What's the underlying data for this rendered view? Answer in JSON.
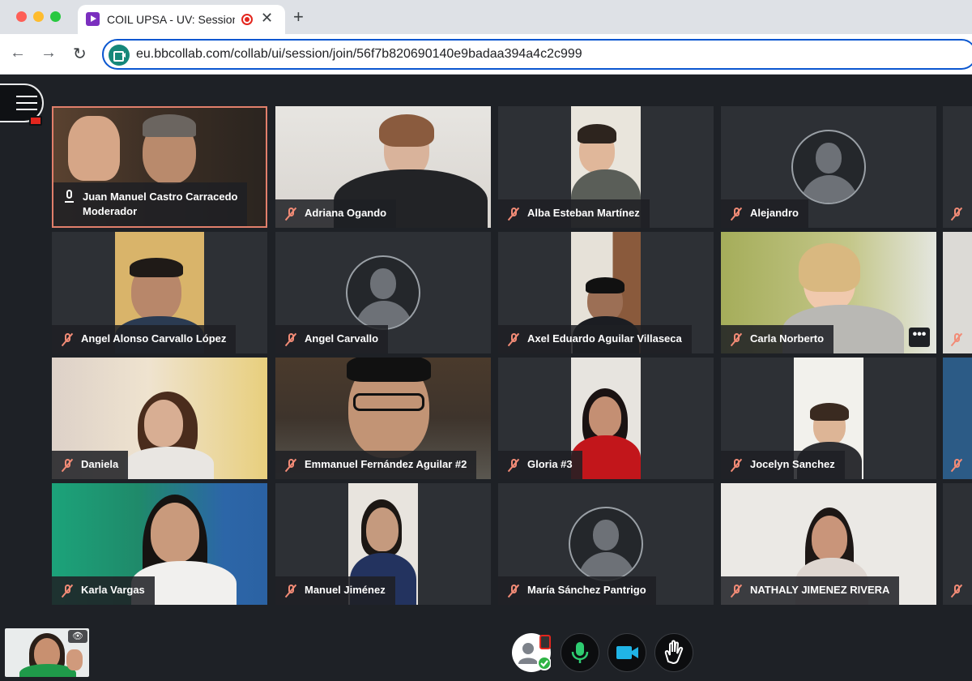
{
  "browser": {
    "tab_title": "COIL UPSA - UV: Session",
    "url": "eu.bbcollab.com/collab/ui/session/join/56f7b820690140e9badaa394a4c2c999"
  },
  "session": {
    "menu_icon": "hamburger-icon",
    "participants": [
      {
        "line1": "Juan Manuel Castro Carracedo",
        "line2": "Moderador",
        "mic": "on",
        "video": true
      },
      {
        "line1": "Adriana Ogando",
        "mic": "muted",
        "video": true
      },
      {
        "line1": "Alba Esteban Martínez",
        "mic": "muted",
        "video": true
      },
      {
        "line1": "Alejandro",
        "mic": "muted",
        "video": false
      },
      {
        "line1": "Angel Alonso Carvallo López",
        "mic": "muted",
        "video": true
      },
      {
        "line1": "Angel Carvallo",
        "mic": "muted",
        "video": false
      },
      {
        "line1": "Axel Eduardo Aguilar Villaseca",
        "mic": "muted",
        "video": true
      },
      {
        "line1": "Carla Norberto",
        "mic": "muted",
        "video": true
      },
      {
        "line1": "Daniela",
        "mic": "muted",
        "video": true
      },
      {
        "line1": "Emmanuel Fernández Aguilar #2",
        "mic": "muted",
        "video": true
      },
      {
        "line1": "Gloria #3",
        "mic": "muted",
        "video": true
      },
      {
        "line1": "Jocelyn Sanchez",
        "mic": "muted",
        "video": true
      },
      {
        "line1": "Karla Vargas",
        "mic": "muted",
        "video": true
      },
      {
        "line1": "Manuel Jiménez",
        "mic": "muted",
        "video": true
      },
      {
        "line1": "María Sánchez Pantrigo",
        "mic": "muted",
        "video": false
      },
      {
        "line1": "NATHALY JIMENEZ RIVERA",
        "mic": "muted",
        "video": true
      }
    ],
    "more_options": "•••"
  },
  "controls": {
    "self_view_icon": "eye-icon",
    "status_icon": "user-status-icon",
    "mic_icon": "microphone-icon",
    "camera_icon": "camera-icon",
    "hand_icon": "raise-hand-icon",
    "colors": {
      "mic_on": "#2ecc71",
      "camera_on": "#20b4e6",
      "talking_border": "#e17f6b",
      "muted": "#f28b76"
    }
  }
}
